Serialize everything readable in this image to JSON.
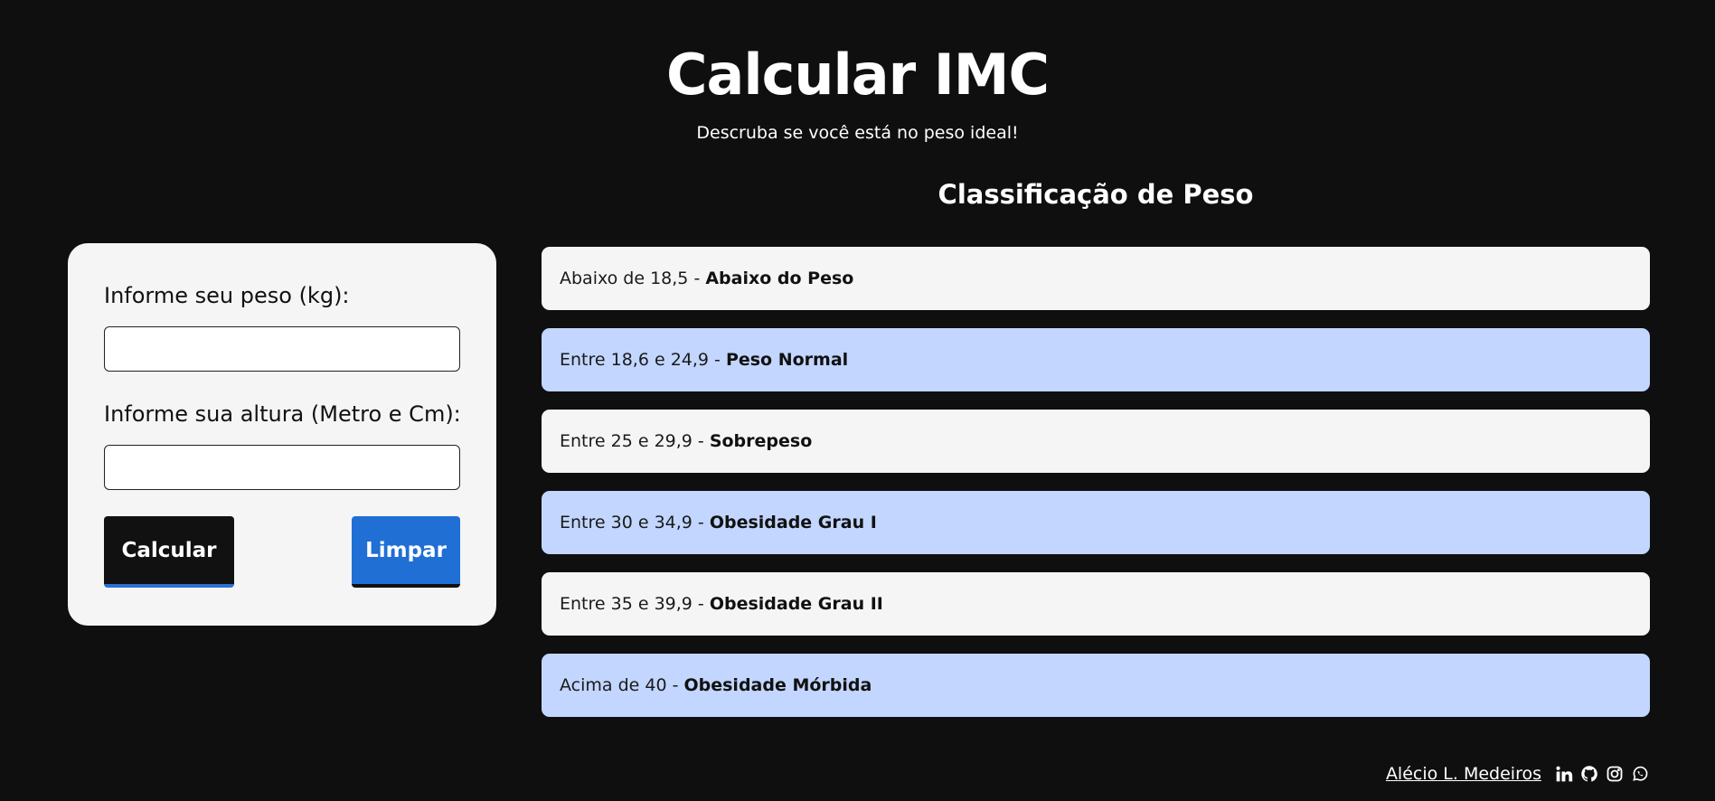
{
  "header": {
    "title": "Calcular IMC",
    "subtitle": "Descruba se você está no peso ideal!"
  },
  "form": {
    "weight_label": "Informe seu peso (kg):",
    "weight_value": "",
    "height_label": "Informe sua altura (Metro e Cm):",
    "height_value": "",
    "calculate_label": "Calcular",
    "clear_label": "Limpar"
  },
  "classification": {
    "title": "Classificação de Peso",
    "separator": " - ",
    "rows": [
      {
        "range": "Abaixo de 18,5",
        "name": "Abaixo do Peso",
        "style": "light"
      },
      {
        "range": "Entre 18,6 e 24,9",
        "name": "Peso Normal",
        "style": "blue"
      },
      {
        "range": "Entre 25 e 29,9",
        "name": "Sobrepeso",
        "style": "light"
      },
      {
        "range": "Entre 30 e 34,9",
        "name": "Obesidade Grau I",
        "style": "blue"
      },
      {
        "range": "Entre 35 e 39,9",
        "name": "Obesidade Grau II",
        "style": "light"
      },
      {
        "range": "Acima de 40",
        "name": "Obesidade Mórbida",
        "style": "blue"
      }
    ]
  },
  "footer": {
    "author": "Alécio L. Medeiros",
    "icons": [
      "linkedin-icon",
      "github-icon",
      "instagram-icon",
      "whatsapp-icon"
    ]
  },
  "colors": {
    "background": "#0f0f0f",
    "card": "#f5f5f5",
    "row_blue": "#c2d6ff",
    "accent_blue": "#1f6fd4"
  }
}
